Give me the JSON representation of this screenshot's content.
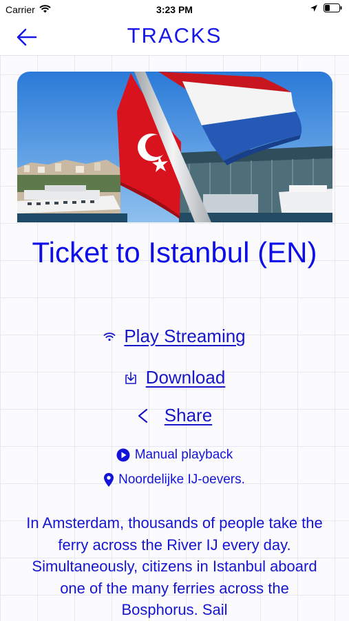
{
  "status_bar": {
    "carrier": "Carrier",
    "time": "3:23 PM"
  },
  "nav": {
    "title": "TRACKS"
  },
  "track": {
    "title": "Ticket to Istanbul (EN)",
    "actions": {
      "play_streaming": "Play Streaming",
      "download": "Download",
      "share": "Share"
    },
    "playback_mode": "Manual playback",
    "location": "Noordelijke IJ-oevers.",
    "description": "In Amsterdam, thousands of people take the ferry across the River IJ every day. Simultaneously, citizens in Istanbul aboard one of the many ferries across the Bosphorus. Sail"
  },
  "colors": {
    "accent": "#1717e8",
    "text_link": "#1717c8"
  }
}
